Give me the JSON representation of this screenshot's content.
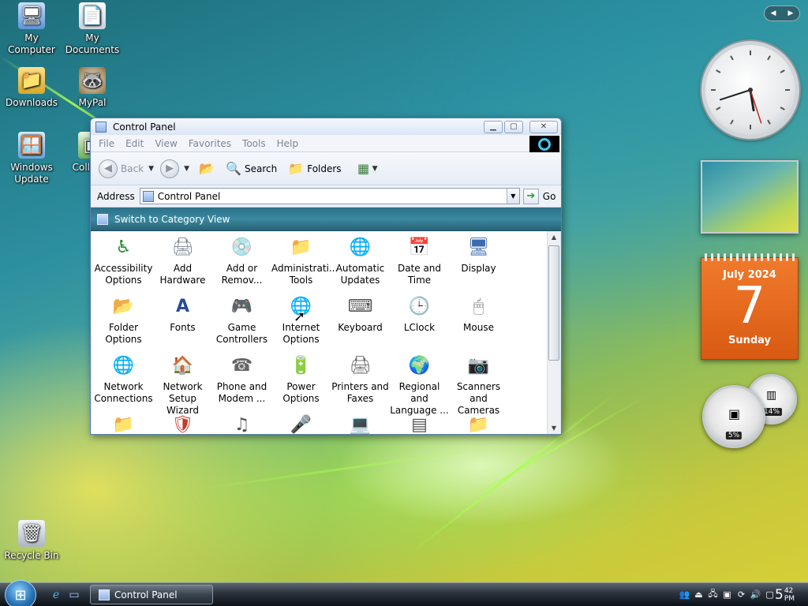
{
  "desktop_icons": [
    {
      "label": "My Computer",
      "icon": "computer-icon"
    },
    {
      "label": "My Documents",
      "icon": "documents-icon"
    },
    {
      "label": "Downloads",
      "icon": "downloads-folder-icon"
    },
    {
      "label": "MyPal",
      "icon": "mypal-browser-icon"
    },
    {
      "label": "Windows Update",
      "icon": "windows-update-icon"
    },
    {
      "label": "Coll",
      "icon": "app-icon"
    },
    {
      "label": "Recycle Bin",
      "icon": "recycle-bin-icon"
    }
  ],
  "window": {
    "title": "Control Panel",
    "menu": [
      "File",
      "Edit",
      "View",
      "Favorites",
      "Tools",
      "Help"
    ],
    "toolbar": {
      "back_label": "Back",
      "search_label": "Search",
      "folders_label": "Folders"
    },
    "address": {
      "label": "Address",
      "value": "Control Panel",
      "go_label": "Go"
    },
    "taskpane": {
      "label": "Switch to Category View"
    },
    "items": [
      {
        "label": "Accessibility Options",
        "icon": "accessibility-icon"
      },
      {
        "label": "Add Hardware",
        "icon": "add-hardware-icon"
      },
      {
        "label": "Add or Remov...",
        "icon": "add-remove-programs-icon"
      },
      {
        "label": "Administrati... Tools",
        "icon": "administrative-tools-icon"
      },
      {
        "label": "Automatic Updates",
        "icon": "automatic-updates-icon"
      },
      {
        "label": "Date and Time",
        "icon": "date-time-icon"
      },
      {
        "label": "Display",
        "icon": "display-icon"
      },
      {
        "label": "Folder Options",
        "icon": "folder-options-icon"
      },
      {
        "label": "Fonts",
        "icon": "fonts-icon"
      },
      {
        "label": "Game Controllers",
        "icon": "game-controller-icon"
      },
      {
        "label": "Internet Options",
        "icon": "internet-options-icon"
      },
      {
        "label": "Keyboard",
        "icon": "keyboard-icon"
      },
      {
        "label": "LClock",
        "icon": "lclock-icon"
      },
      {
        "label": "Mouse",
        "icon": "mouse-icon"
      },
      {
        "label": "Network Connections",
        "icon": "network-connections-icon"
      },
      {
        "label": "Network Setup Wizard",
        "icon": "network-setup-icon"
      },
      {
        "label": "Phone and Modem ...",
        "icon": "phone-modem-icon"
      },
      {
        "label": "Power Options",
        "icon": "power-options-icon"
      },
      {
        "label": "Printers and Faxes",
        "icon": "printer-icon"
      },
      {
        "label": "Regional and Language ...",
        "icon": "regional-language-icon"
      },
      {
        "label": "Scanners and Cameras",
        "icon": "scanner-camera-icon"
      },
      {
        "label": "",
        "icon": "scheduled-tasks-icon"
      },
      {
        "label": "",
        "icon": "security-center-icon"
      },
      {
        "label": "",
        "icon": "sounds-icon"
      },
      {
        "label": "",
        "icon": "speech-icon"
      },
      {
        "label": "",
        "icon": "system-icon"
      },
      {
        "label": "",
        "icon": "taskbar-icon"
      },
      {
        "label": "",
        "icon": "user-accounts-icon"
      }
    ]
  },
  "gadgets": {
    "clock": {
      "hour": 5,
      "minute": 42
    },
    "calendar": {
      "month": "July 2024",
      "day": "7",
      "weekday": "Sunday"
    },
    "cpu_meter": {
      "cpu": "5%",
      "memory": "14%"
    }
  },
  "taskbar": {
    "task_label": "Control Panel",
    "time_hour": "5",
    "time_minute": "42",
    "time_ampm": "PM"
  },
  "colors": {
    "calendar_orange": "#e8681e",
    "taskpane_teal": "#2f7890",
    "window_border": "#5a7fb8"
  }
}
